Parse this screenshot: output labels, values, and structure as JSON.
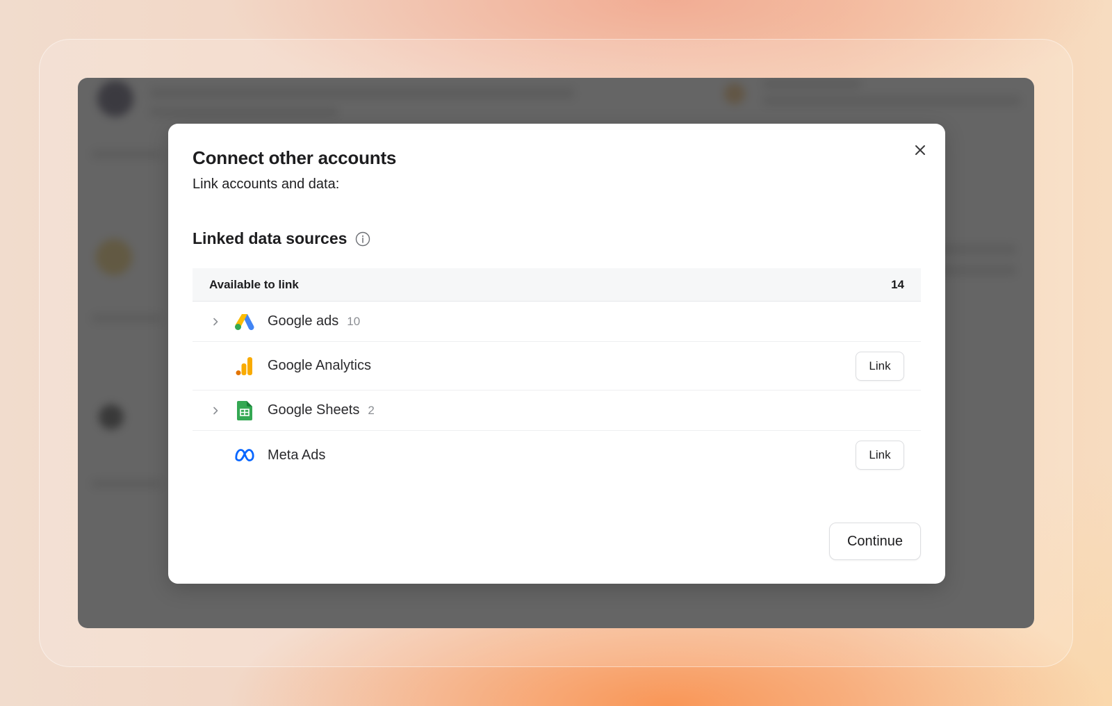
{
  "modal": {
    "title": "Connect other accounts",
    "subtitle": "Link accounts and data:",
    "section_title": "Linked data sources",
    "table": {
      "header_label": "Available to link",
      "header_count": "14",
      "rows": [
        {
          "name": "Google ads",
          "count": "10",
          "icon": "google-ads-icon",
          "expandable": true
        },
        {
          "name": "Google Analytics",
          "icon": "google-analytics-icon",
          "action": "Link"
        },
        {
          "name": "Google Sheets",
          "count": "2",
          "icon": "google-sheets-icon",
          "expandable": true
        },
        {
          "name": "Meta Ads",
          "icon": "meta-icon",
          "action": "Link"
        }
      ]
    },
    "continue_label": "Continue"
  },
  "colors": {
    "overlay": "#3c3c3c",
    "google_blue": "#4285F4",
    "google_yellow": "#FBBC04",
    "google_green": "#34A853",
    "analytics_orange": "#F9AB00",
    "sheets_green": "#34A853",
    "meta_blue": "#0866FF"
  }
}
